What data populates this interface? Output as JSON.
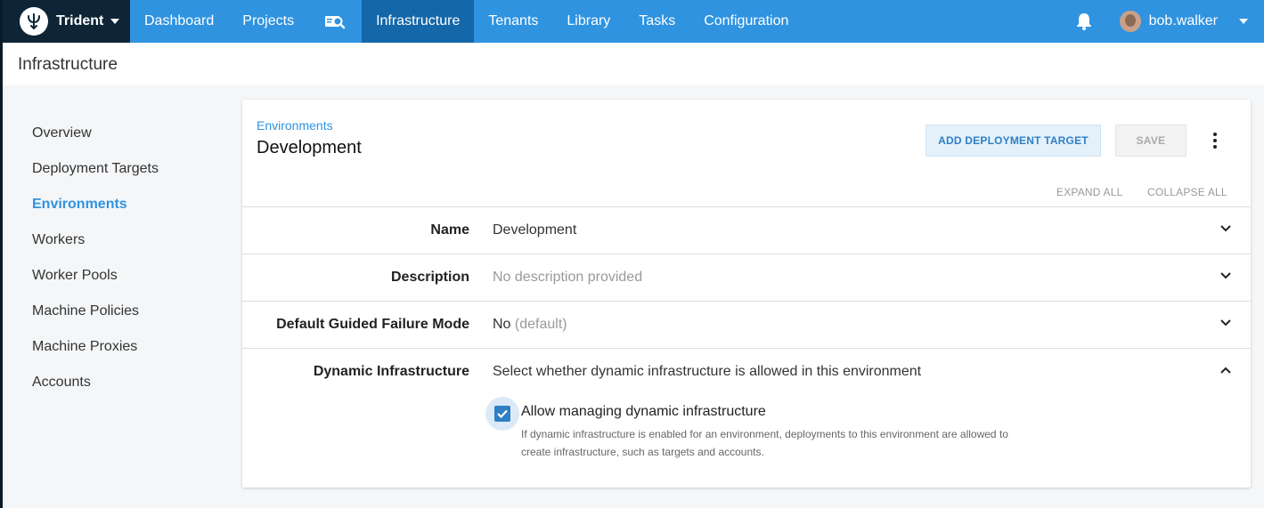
{
  "topnav": {
    "brand": "Trident",
    "items": [
      {
        "label": "Dashboard"
      },
      {
        "label": "Projects"
      },
      {
        "label": "Infrastructure",
        "active": true
      },
      {
        "label": "Tenants"
      },
      {
        "label": "Library"
      },
      {
        "label": "Tasks"
      },
      {
        "label": "Configuration"
      }
    ],
    "user": "bob.walker",
    "bar_color": "#2f93e0",
    "active_color": "#1467a8",
    "brand_color": "#0f2535"
  },
  "page": {
    "title": "Infrastructure"
  },
  "sidebar": {
    "items": [
      {
        "label": "Overview"
      },
      {
        "label": "Deployment Targets"
      },
      {
        "label": "Environments",
        "active": true
      },
      {
        "label": "Workers"
      },
      {
        "label": "Worker Pools"
      },
      {
        "label": "Machine Policies"
      },
      {
        "label": "Machine Proxies"
      },
      {
        "label": "Accounts"
      }
    ]
  },
  "card": {
    "breadcrumb": "Environments",
    "title": "Development",
    "add_button": "ADD DEPLOYMENT TARGET",
    "save_button": "SAVE",
    "expand_all": "EXPAND ALL",
    "collapse_all": "COLLAPSE ALL",
    "rows": [
      {
        "label": "Name",
        "value": "Development"
      },
      {
        "label": "Description",
        "value": "No description provided"
      },
      {
        "label": "Default Guided Failure Mode",
        "value": "No",
        "hint": "(default)"
      },
      {
        "label": "Dynamic Infrastructure",
        "value": "Select whether dynamic infrastructure is allowed in this environment"
      }
    ],
    "checkbox": {
      "checked": true,
      "label": "Allow managing dynamic infrastructure",
      "help": "If dynamic infrastructure is enabled for an environment, deployments to this environment are allowed to create infrastructure, such as targets and accounts."
    }
  }
}
